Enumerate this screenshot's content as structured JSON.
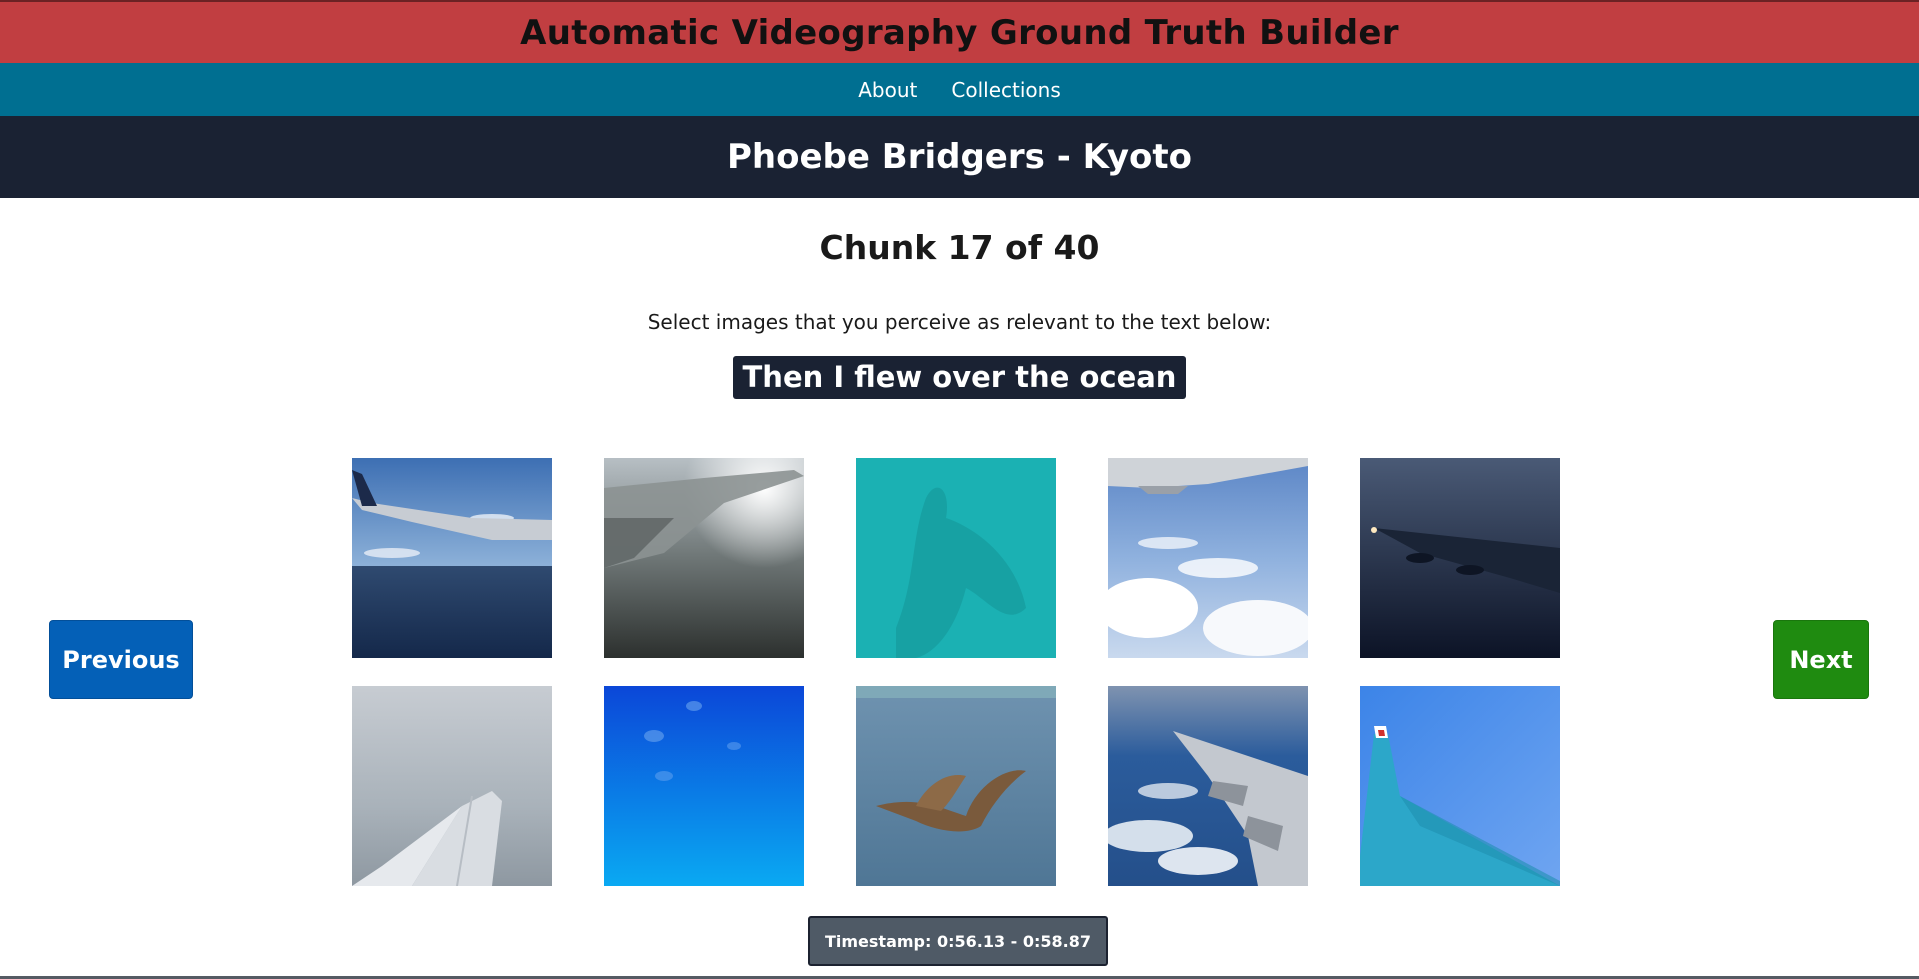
{
  "app": {
    "title": "Automatic Videography Ground Truth Builder"
  },
  "nav": {
    "items": [
      {
        "label": "About"
      },
      {
        "label": "Collections"
      }
    ]
  },
  "video": {
    "title": "Phoebe Bridgers - Kyoto"
  },
  "chunk": {
    "heading": "Chunk 17 of 40",
    "instruction": "Select images that you perceive as relevant to the text below:",
    "lyric": "Then I flew over the ocean",
    "timestamp": "Timestamp: 0:56.13 - 0:58.87"
  },
  "buttons": {
    "previous": "Previous",
    "next": "Next"
  },
  "colors": {
    "title_bar": "#c13e41",
    "nav_bar": "#006f91",
    "header_dark": "#1a2233",
    "previous_button": "#0460b7",
    "next_button": "#1f8b10",
    "timestamp_bg": "#4f5a66"
  },
  "images": [
    {
      "icon": "airplane-wing-over-sea-image"
    },
    {
      "icon": "airplane-wing-hazy-sun-image"
    },
    {
      "icon": "turquoise-water-shadow-image"
    },
    {
      "icon": "airplane-wing-over-clouds-image"
    },
    {
      "icon": "airplane-wing-night-image"
    },
    {
      "icon": "airplane-wing-overcast-image"
    },
    {
      "icon": "blue-sky-underwater-image"
    },
    {
      "icon": "pelican-over-ocean-image"
    },
    {
      "icon": "airplane-wing-flaps-clouds-image"
    },
    {
      "icon": "turquoise-winglet-sky-image"
    }
  ]
}
